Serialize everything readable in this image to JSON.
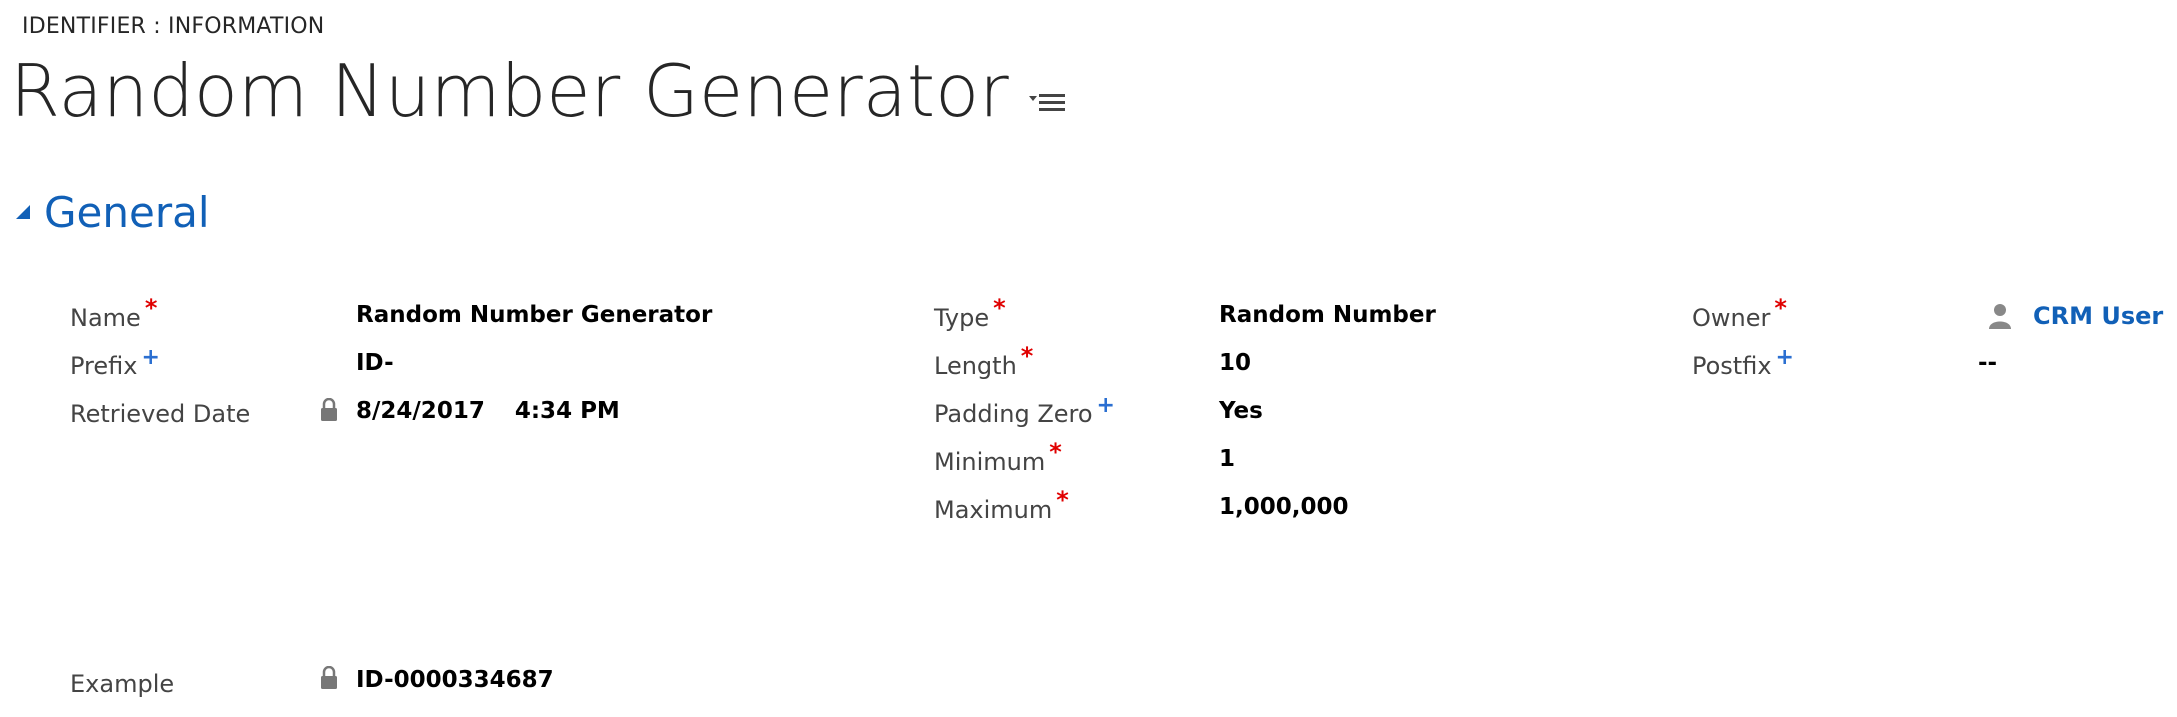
{
  "breadcrumb": "IDENTIFIER : INFORMATION",
  "page_title": "Random Number Generator",
  "form_menu_icon": "form-menu-icon",
  "section": {
    "title": "General",
    "toggle_icon": "collapse-triangle-icon"
  },
  "fields": {
    "name": {
      "label": "Name",
      "marker": "*",
      "value": "Random Number Generator"
    },
    "prefix": {
      "label": "Prefix",
      "marker": "+",
      "value": "ID-"
    },
    "retrieved_date": {
      "label": "Retrieved Date",
      "date": "8/24/2017",
      "time": "4:34 PM",
      "icon": "lock-icon"
    },
    "type": {
      "label": "Type",
      "marker": "*",
      "value": "Random Number"
    },
    "length": {
      "label": "Length",
      "marker": "*",
      "value": "10"
    },
    "padding_zero": {
      "label": "Padding Zero",
      "marker": "+",
      "value": "Yes"
    },
    "minimum": {
      "label": "Minimum",
      "marker": "*",
      "value": "1"
    },
    "maximum": {
      "label": "Maximum",
      "marker": "*",
      "value": "1,000,000"
    },
    "owner": {
      "label": "Owner",
      "marker": "*",
      "value": "CRM User",
      "icon": "user-icon"
    },
    "postfix": {
      "label": "Postfix",
      "marker": "+",
      "value": "--"
    },
    "example": {
      "label": "Example",
      "value": "ID-0000334687",
      "icon": "lock-icon"
    }
  },
  "colors": {
    "accent": "#1160b7",
    "required": "#e00000",
    "recommended": "#2b6fd1"
  }
}
